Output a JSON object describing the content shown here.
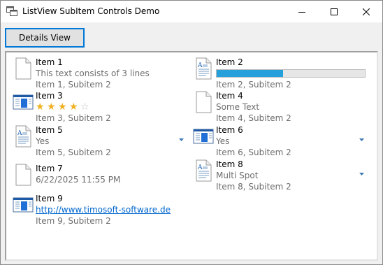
{
  "window": {
    "title": "ListView SubItem Controls Demo"
  },
  "toolbar": {
    "details_label": "Details View"
  },
  "items": [
    {
      "title": "Item 1",
      "sub1": "This text consists of 3 lines",
      "sub2": "Item 1, Subitem 2",
      "icon": "blank-document-icon"
    },
    {
      "title": "Item 2",
      "progress": 0.45,
      "sub2": "Item 2, Subitem 2",
      "icon": "wordpad-document-icon"
    },
    {
      "title": "Item 3",
      "rating": 4,
      "rating_max": 5,
      "sub2": "Item 3, Subitem 2",
      "icon": "window-icon"
    },
    {
      "title": "Item 4",
      "sub1": "Some Text",
      "sub2": "Item 4, Subitem 2",
      "icon": "blank-document-icon"
    },
    {
      "title": "Item 5",
      "sub1": "Yes",
      "sub2": "Item 5, Subitem 2",
      "icon": "wordpad-document-icon"
    },
    {
      "title": "Item 6",
      "sub1": "Yes",
      "sub2": "Item 6, Subitem 2",
      "icon": "window-icon"
    },
    {
      "title": "Item 7",
      "sub1": "6/22/2025 11:55 PM",
      "sub2": "",
      "icon": "blank-document-icon"
    },
    {
      "title": "Item 8",
      "sub1": "Multi Spot",
      "sub2": "Item 8, Subitem 2",
      "icon": "wordpad-document-icon"
    },
    {
      "title": "Item 9",
      "link": "http://www.timosoft-software.de",
      "sub2": "Item 9, Subitem 2",
      "icon": "window-icon"
    }
  ],
  "colors": {
    "accent": "#0078d7",
    "progress": "#26a0da",
    "star": "#f0b020",
    "link": "#0066cc",
    "subtext": "#6d6d6d"
  }
}
